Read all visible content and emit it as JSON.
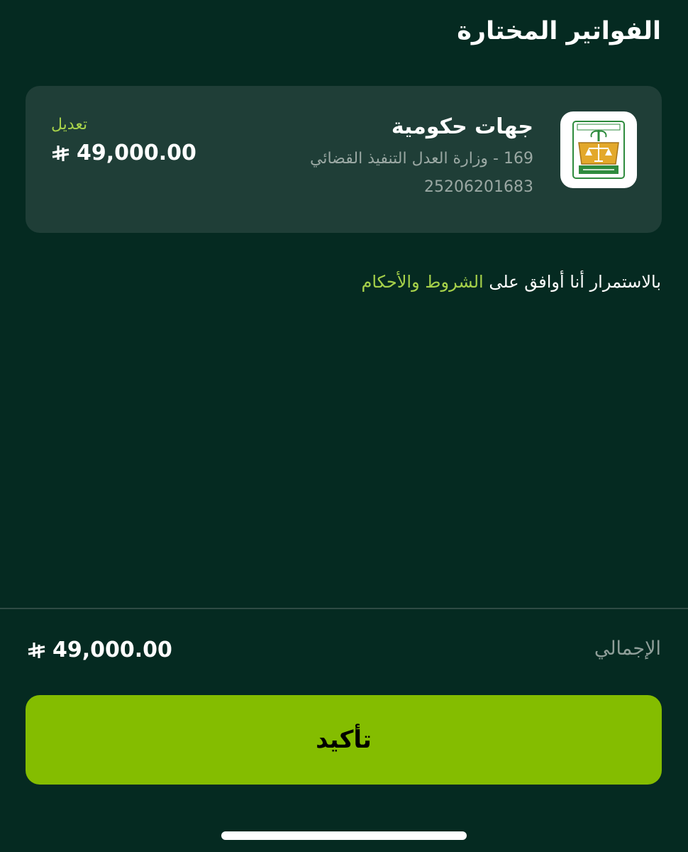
{
  "header": {
    "title": "الفواتير المختارة"
  },
  "bill": {
    "category": "جهات حكومية",
    "issuer": "169 - وزارة العدل التنفيذ القضائي",
    "bill_number": "25206201683",
    "edit_label": "تعديل",
    "amount": "49,000.00",
    "logo_icon": "ministry-of-justice-logo"
  },
  "terms": {
    "prefix": "بالاستمرار أنا أوافق على",
    "link_label": "الشروط والأحكام"
  },
  "summary": {
    "total_label": "الإجمالي",
    "total_amount": "49,000.00"
  },
  "actions": {
    "confirm_label": "تأكيد"
  },
  "currency": {
    "icon": "saudi-riyal-icon"
  },
  "colors": {
    "background": "#052a21",
    "card": "#1f3e37",
    "accent": "#84bd00",
    "link": "#a6d14a"
  }
}
